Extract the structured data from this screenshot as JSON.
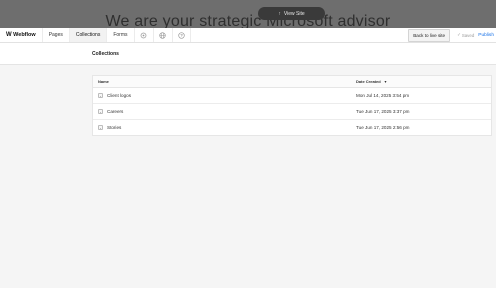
{
  "site_preview": {
    "headline": "We are your strategic Microsoft advisor",
    "view_site_label": "View Site"
  },
  "toolbar": {
    "logo_label": "Webflow",
    "tabs": [
      {
        "label": "Pages",
        "active": false
      },
      {
        "label": "Collections",
        "active": true
      },
      {
        "label": "Forms",
        "active": false
      }
    ],
    "icons": [
      "settings-icon",
      "globe-icon",
      "help-icon"
    ],
    "back_label": "Back to live site",
    "saved_label": "Saved",
    "publish_label": "Publish"
  },
  "page": {
    "title": "Collections"
  },
  "table": {
    "columns": [
      "Name",
      "Date Created"
    ],
    "sort_column": "Date Created",
    "rows": [
      {
        "name": "Client logos",
        "date": "Mon Jul 14, 2025 3:54 pm"
      },
      {
        "name": "Careers",
        "date": "Tue Jun 17, 2025 3:37 pm"
      },
      {
        "name": "Stories",
        "date": "Tue Jun 17, 2025 2:56 pm"
      }
    ]
  },
  "colors": {
    "accent": "#1a73e8",
    "preview_overlay": "#6e6e6e",
    "background": "#f5f5f5"
  }
}
